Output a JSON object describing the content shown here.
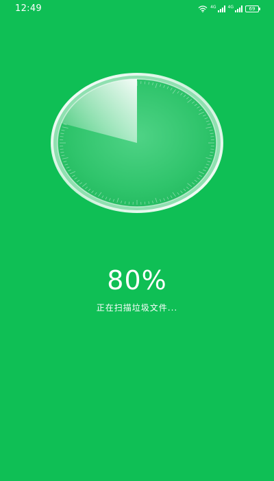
{
  "status_bar": {
    "time": "12:49",
    "signal1_label": "4G",
    "signal2_label": "4G",
    "battery_level": "69"
  },
  "scan": {
    "percent_text": "80%",
    "progress": 0.8,
    "status_text": "正在扫描垃圾文件..."
  },
  "colors": {
    "background": "#0fbf55",
    "gauge_fill": "#35c872",
    "text": "#ffffff"
  }
}
